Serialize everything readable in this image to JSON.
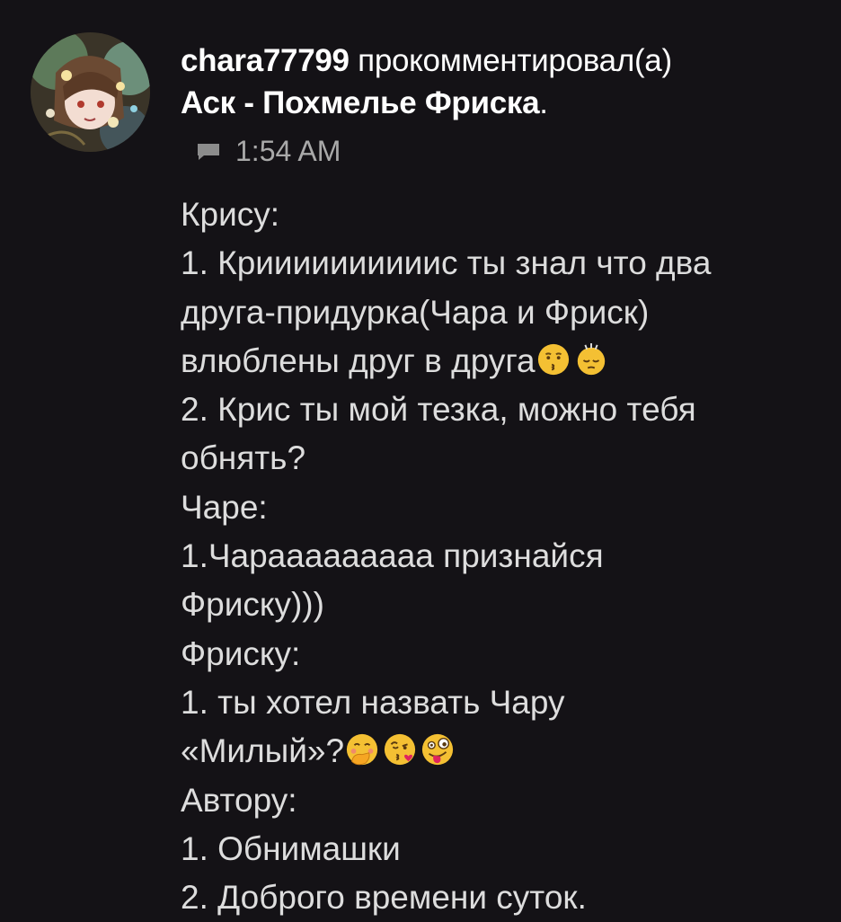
{
  "comment": {
    "username": "chara77799",
    "action": "прокомментировал(а)",
    "post_title": "Аск - Похмелье Фриска",
    "post_title_end": ".",
    "time": "1:54 AM",
    "avatar_icon": "anime-avatar",
    "meta_icon": "comment-bubble-icon"
  },
  "body": {
    "l1": "Крису:",
    "l2": "1. Криииииииииис ты знал что два",
    "l3": "друга-придурка(Чара и Фриск)",
    "l4": "влюблены друг в друга",
    "l5": "2. Крис ты мой тезка, можно тебя",
    "l6": "обнять?",
    "l7": "Чаре:",
    "l8": "1.Чарааааааааа признайся",
    "l9": "Фриску)))",
    "l10": "Фриску:",
    "l11": "1. ты хотел назвать Чару",
    "l12": "«Милый»?",
    "l13": "Автору:",
    "l14": "1. Обнимашки",
    "l15": "2. Доброго времени суток."
  },
  "emojis": {
    "line4": [
      "kissing-face-emoji",
      "persevering-face-emoji"
    ],
    "line12": [
      "hand-over-mouth-emoji",
      "blowing-kiss-emoji",
      "zany-face-emoji"
    ]
  },
  "colors": {
    "background": "#141216",
    "text": "#dddddd",
    "muted": "#a9a9a9",
    "emoji_yellow": "#f4c033"
  }
}
